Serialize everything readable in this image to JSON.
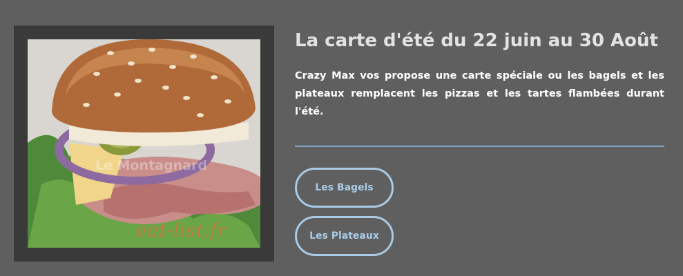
{
  "section": {
    "title": "La carte d'été du 22 juin au 30 Août",
    "description": "Crazy Max vos propose une carte spéciale ou les bagels et les plateaux remplacent les pizzas et les tartes flambées durant l'été."
  },
  "image": {
    "caption": "eat-list.fr",
    "watermark": "Le Montagnard"
  },
  "buttons": {
    "bagels": "Les Bagels",
    "plateaux": "Les Plateaux"
  },
  "colors": {
    "background": "#5f5f5f",
    "frame": "#3a3a3a",
    "accent": "#a9cbe6",
    "title": "#e2e2e2"
  }
}
